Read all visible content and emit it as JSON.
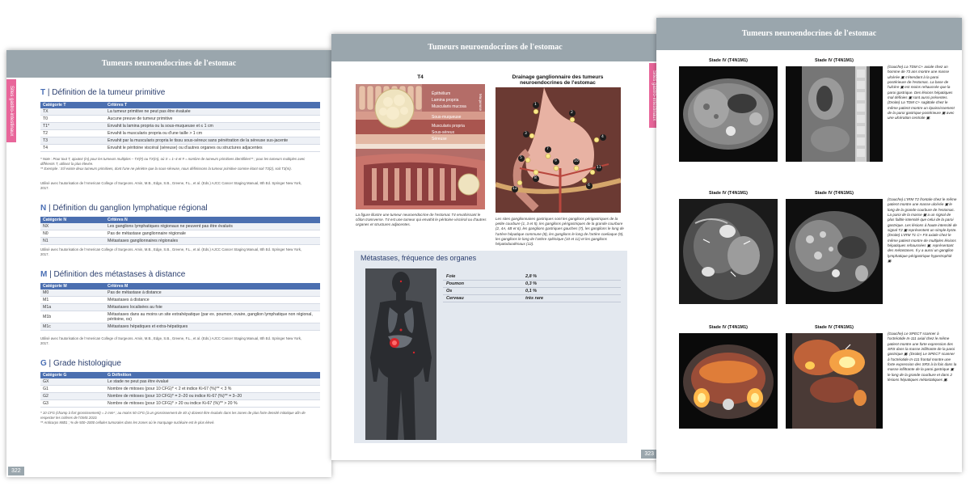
{
  "page_left": {
    "banner": "Tumeurs neuroendocrines de l'estomac",
    "side_tab": "Sites gastro-intestinaux",
    "page_number": "322",
    "t_section": {
      "letter": "T",
      "title": "Définition de la tumeur primitive",
      "headers": [
        "Catégorie T",
        "Critères T"
      ],
      "rows": [
        [
          "TX",
          "La tumeur primitive ne peut pas être évaluée"
        ],
        [
          "T0",
          "Aucune preuve de tumeur primitive"
        ],
        [
          "T1*",
          "Envahit la lamina propria ou la sous-muqueuse et ≤ 1 cm"
        ],
        [
          "T2",
          "Envahit la muscularis propria ou d'une taille > 1 cm"
        ],
        [
          "T3",
          "Envahit par la muscularis propria le tissu sous-séreux sans pénétration de la séreuse sus-jacente"
        ],
        [
          "T4",
          "Envahit le péritoine viscéral (séreuse) ou d'autres organes ou structures adjacentes"
        ]
      ],
      "notes": [
        "* Note : Pour tout T, ajoutez (m) pour les tumeurs multiples – TX(#) ou TX(m), où X = 1–4 et # = nombre de tumeurs primitives identifiées** ; pour les tumeurs multiples avec différents T, utilisez la plus élevée.",
        "** Exemple : S'il existe deux tumeurs primitives, dont l'une ne pénètre que la sous-séreuse, nous définissons la tumeur primitive comme étant soit T3(2), soit T3(m)."
      ],
      "source": "Utilisé avec l'autorisation de l'American College of Surgeons. Amin, M.B., Edge, S.B., Greene, F.L., et al. (Eds.) AJCC Cancer Staging Manual, 8th Ed. Springer New York, 2017."
    },
    "n_section": {
      "letter": "N",
      "title": "Définition du ganglion lymphatique régional",
      "headers": [
        "Catégorie N",
        "Critères N"
      ],
      "rows": [
        [
          "NX",
          "Les ganglions lymphatiques régionaux ne peuvent pas être évalués"
        ],
        [
          "N0",
          "Pas de métastase ganglionnaire régionale"
        ],
        [
          "N1",
          "Métastases ganglionnaires régionales"
        ]
      ],
      "source": "Utilisé avec l'autorisation de l'American College of Surgeons. Amin, M.B., Edge, S.B., Greene, F.L., et al. (Eds.) AJCC Cancer Staging Manual, 8th Ed. Springer New York, 2017."
    },
    "m_section": {
      "letter": "M",
      "title": "Définition des métastases à distance",
      "headers": [
        "Catégorie M",
        "Critères M"
      ],
      "rows": [
        [
          "M0",
          "Pas de métastase à distance"
        ],
        [
          "M1",
          "Métastases à distance"
        ],
        [
          "M1a",
          "Métastases localisées au foie"
        ],
        [
          "M1b",
          "Métastases dans au moins un site extrahépatique (par ex. poumon, ovaire, ganglion lymphatique non régional, péritoine, os)"
        ],
        [
          "M1c",
          "Métastases hépatiques et extra-hépatiques"
        ]
      ],
      "source": "Utilisé avec l'autorisation de l'American College of Surgeons. Amin, M.B., Edge, S.B., Greene, F.L., et al. (Eds.) AJCC Cancer Staging Manual, 8th Ed. Springer New York, 2017."
    },
    "g_section": {
      "letter": "G",
      "title": "Grade histologique",
      "headers": [
        "Catégorie G",
        "G Définition"
      ],
      "rows": [
        [
          "GX",
          "Le stade ne peut pas être évalué"
        ],
        [
          "G1",
          "Nombre de mitoses (pour 10 CFG)* < 2 et indice Ki-67 (%)** < 3 %"
        ],
        [
          "G2",
          "Nombre de mitoses (pour 10 CFG)* = 2–20 ou indice Ki-67 (%)** = 3–20"
        ],
        [
          "G3",
          "Nombre de mitoses (pour 10 CFG)* > 20 ou indice Ki-67 (%)** > 20 %"
        ]
      ],
      "notes": [
        "* 10 CFG (champ à fort grossissement) = 2 mm² ; au moins 50 CFG (à un grossissement de 40 x) doivent être évalués dans les zones de plus forte densité mitotique afin de respecter les critères de l'OMS 2010.",
        "** Anticorps MIB1 ; % de 500–2000 cellules tumorales dans les zones où le marquage nucléaire est le plus élevé."
      ]
    }
  },
  "page_middle": {
    "banner": "Tumeurs neuroendocrines de l'estomac",
    "side_tab": "Sites gastro-intestinaux",
    "page_number": "323",
    "fig_t4_title": "T4",
    "layer_labels": [
      "Épithélium",
      "Lamina propria",
      "Muscularis mucosa",
      "Sous-muqueuse",
      "Muscularis propria",
      "Sous-séreux",
      "Séreuse"
    ],
    "layer_side_label": "Muqueuse",
    "fig_t4_caption": "La figure illustre une tumeur neuroendocrine de l'estomac T4 envahissant le côlon transverse. T4 est une tumeur qui envahit le péritoine viscéral ou d'autres organes et structures adjacentes.",
    "fig_drain_title": "Drainage ganglionnaire des tumeurs neuroendocrines de l'estomac",
    "node_numbers": [
      "1",
      "2",
      "3",
      "4",
      "5",
      "6",
      "7",
      "8",
      "9",
      "10",
      "11",
      "12"
    ],
    "fig_drain_caption": "Les sites ganglionnaires gastriques sont les ganglions périgastriques de la petite courbure (1, 3 et 5), les ganglions périgastriques de la grande courbure (2, 4A, 4B et 6), les ganglions gastriques gauches (7), les ganglions le long de l'artère hépatique commune (8), les ganglions le long de l'artère coeliaque (9), les ganglions le long de l'artère splénique (10 et 11) et les ganglions hépatoduodénaux (12).",
    "metastases_title": "Métastases, fréquence des organes",
    "metastases": [
      {
        "organ": "Foie",
        "freq": "2,8 %"
      },
      {
        "organ": "Poumon",
        "freq": "0,3 %"
      },
      {
        "organ": "Os",
        "freq": "0,1 %"
      },
      {
        "organ": "Cerveau",
        "freq": "très rare"
      }
    ]
  },
  "page_right": {
    "banner": "Tumeurs neuroendocrines de l'estomac",
    "rows": [
      {
        "labels": [
          "Stade IV (T4N1M1)",
          "Stade IV (T4N1M1)"
        ],
        "caption": "(Gauche) La TDM C+ axiale chez un homme de 73 ans montre une masse ulcérée ▣ s'étendant à la paroi postérieure de l'estomac. La base de l'ulcère ▣ est moins rehaussée que la paroi gastrique. Des lésions hépatiques mal définies ▣ sont aussi présentes. (Droite) La TDM C+ sagittale chez le même patient montre un épaississement de la paroi gastrique postérieure ▣ avec une ulcération centrale ▣."
      },
      {
        "labels": [
          "Stade IV (T4N1M1)",
          "Stade IV (T4N1M1)"
        ],
        "caption": "(Gauche) L'IRM T2 frontale chez le même patient montre une masse ulcérée ▣ le long de la grande courbure de l'estomac. La paroi de la masse ▣ a un signal de plus faible intensité que celui de la paroi gastrique. Les lésions à haute intensité de signal T2 ▣ représentent un simple kyste. (Droite) L'IRM T1 C+ FS axiale chez le même patient montre de multiples lésions hépatiques rehaussées ▣, représentant des métastases. Il y a aussi un ganglion lymphatique périgastrique hypertrophié ▣."
      },
      {
        "labels": [
          "Stade IV (T4N1M1)",
          "Stade IV (T4N1M1)"
        ],
        "caption": "(Gauche) Le SPECT scanner à l'octréotide In-111 axial chez le même patient montre une forte expression des SRS dans la masse infiltrante de la paroi gastrique ▣. (Droite) Le SPECT scanner à l'octréotide In-111 frontal montre une forte expression des SRS à la fois dans la masse infiltrante de la paroi gastrique ▣ le long de la grande courbure et dans 2 lésions hépatiques métastatiques ▣."
      }
    ]
  },
  "colors": {
    "banner": "#9aa6ad",
    "side_tab": "#e8669a",
    "table_header": "#4b6fb0",
    "section_title": "#2a3e6e"
  }
}
